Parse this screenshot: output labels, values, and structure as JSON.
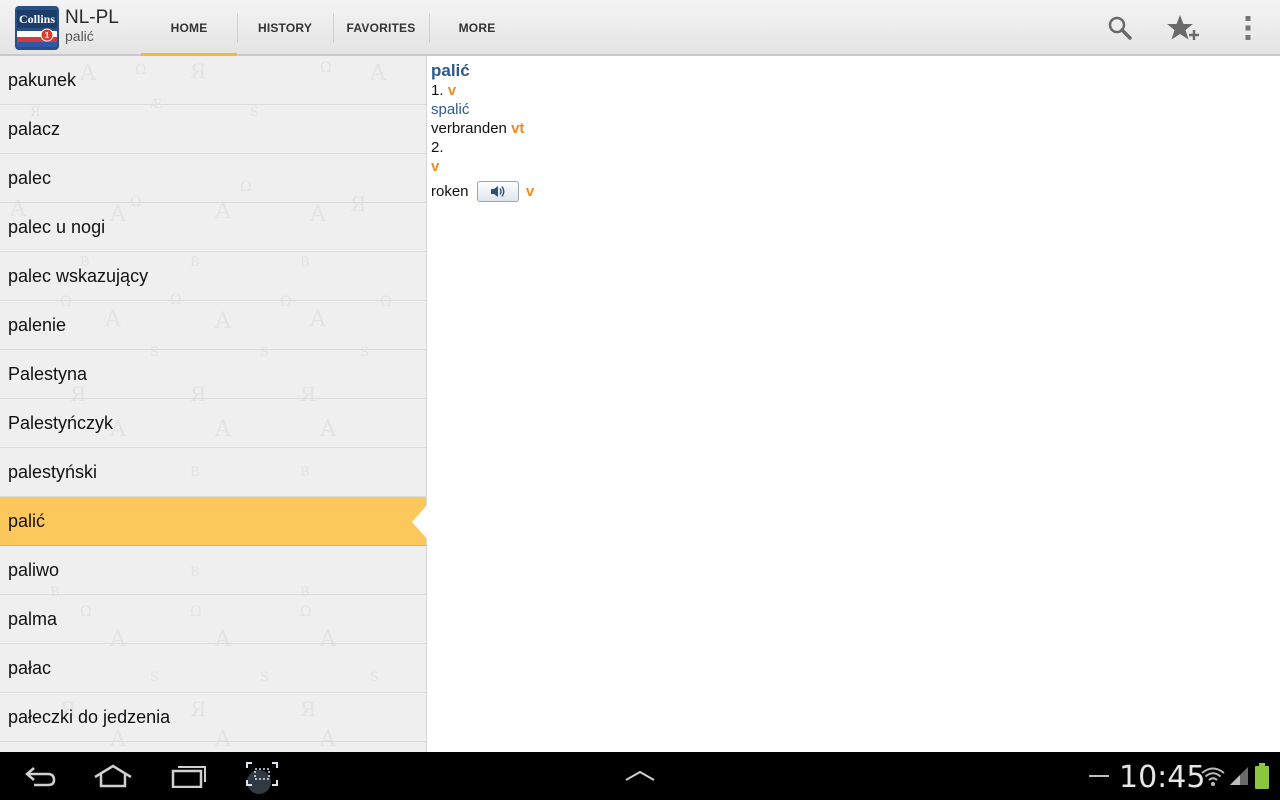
{
  "header": {
    "title": "NL-PL",
    "subtitle": "palić",
    "tabs": [
      {
        "label": "HOME",
        "active": true
      },
      {
        "label": "HISTORY",
        "active": false
      },
      {
        "label": "FAVORITES",
        "active": false
      },
      {
        "label": "MORE",
        "active": false
      }
    ],
    "actions": [
      "search-icon",
      "add-favorite-star-icon",
      "overflow-menu-icon"
    ]
  },
  "word_list": {
    "items": [
      "pakunek",
      "palacz",
      "palec",
      "palec u nogi",
      "palec wskazujący",
      "palenie",
      "Palestyna",
      "Palestyńczyk",
      "palestyński",
      "palić",
      "paliwo",
      "palma",
      "pałac",
      "pałeczki do jedzenia"
    ],
    "selected_index": 9
  },
  "entry": {
    "headword": "palić",
    "sense1_num": "1.",
    "sense1_pos": "v",
    "sense1_translation": "spalić",
    "sense1_target": "verbranden",
    "sense1_target_pos": "vt",
    "sense2_num": "2.",
    "sense2_pos": "v",
    "sense2_target": "roken",
    "sense2_target_pos": "v"
  },
  "system_bar": {
    "time": "10:45",
    "icons": [
      "back-icon",
      "home-icon",
      "recent-apps-icon",
      "screenshot-icon",
      "expand-up-icon",
      "wifi-icon",
      "signal-icon",
      "battery-icon"
    ]
  },
  "colors": {
    "accent": "#f7b731",
    "selected_row": "#fcc85b",
    "headword": "#2d5a8c",
    "pos": "#f08c22"
  }
}
